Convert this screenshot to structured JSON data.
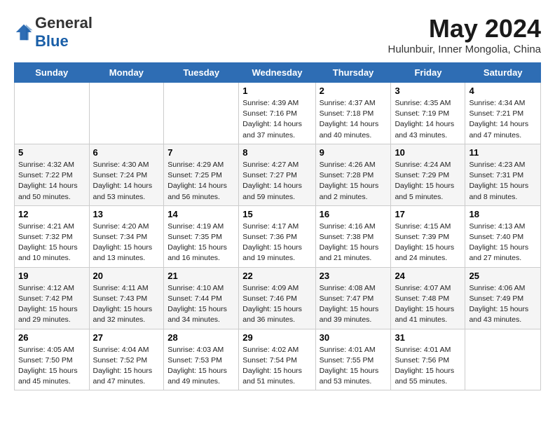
{
  "logo": {
    "general": "General",
    "blue": "Blue"
  },
  "title": "May 2024",
  "subtitle": "Hulunbuir, Inner Mongolia, China",
  "days_of_week": [
    "Sunday",
    "Monday",
    "Tuesday",
    "Wednesday",
    "Thursday",
    "Friday",
    "Saturday"
  ],
  "weeks": [
    [
      {
        "day": "",
        "info": ""
      },
      {
        "day": "",
        "info": ""
      },
      {
        "day": "",
        "info": ""
      },
      {
        "day": "1",
        "info": "Sunrise: 4:39 AM\nSunset: 7:16 PM\nDaylight: 14 hours and 37 minutes."
      },
      {
        "day": "2",
        "info": "Sunrise: 4:37 AM\nSunset: 7:18 PM\nDaylight: 14 hours and 40 minutes."
      },
      {
        "day": "3",
        "info": "Sunrise: 4:35 AM\nSunset: 7:19 PM\nDaylight: 14 hours and 43 minutes."
      },
      {
        "day": "4",
        "info": "Sunrise: 4:34 AM\nSunset: 7:21 PM\nDaylight: 14 hours and 47 minutes."
      }
    ],
    [
      {
        "day": "5",
        "info": "Sunrise: 4:32 AM\nSunset: 7:22 PM\nDaylight: 14 hours and 50 minutes."
      },
      {
        "day": "6",
        "info": "Sunrise: 4:30 AM\nSunset: 7:24 PM\nDaylight: 14 hours and 53 minutes."
      },
      {
        "day": "7",
        "info": "Sunrise: 4:29 AM\nSunset: 7:25 PM\nDaylight: 14 hours and 56 minutes."
      },
      {
        "day": "8",
        "info": "Sunrise: 4:27 AM\nSunset: 7:27 PM\nDaylight: 14 hours and 59 minutes."
      },
      {
        "day": "9",
        "info": "Sunrise: 4:26 AM\nSunset: 7:28 PM\nDaylight: 15 hours and 2 minutes."
      },
      {
        "day": "10",
        "info": "Sunrise: 4:24 AM\nSunset: 7:29 PM\nDaylight: 15 hours and 5 minutes."
      },
      {
        "day": "11",
        "info": "Sunrise: 4:23 AM\nSunset: 7:31 PM\nDaylight: 15 hours and 8 minutes."
      }
    ],
    [
      {
        "day": "12",
        "info": "Sunrise: 4:21 AM\nSunset: 7:32 PM\nDaylight: 15 hours and 10 minutes."
      },
      {
        "day": "13",
        "info": "Sunrise: 4:20 AM\nSunset: 7:34 PM\nDaylight: 15 hours and 13 minutes."
      },
      {
        "day": "14",
        "info": "Sunrise: 4:19 AM\nSunset: 7:35 PM\nDaylight: 15 hours and 16 minutes."
      },
      {
        "day": "15",
        "info": "Sunrise: 4:17 AM\nSunset: 7:36 PM\nDaylight: 15 hours and 19 minutes."
      },
      {
        "day": "16",
        "info": "Sunrise: 4:16 AM\nSunset: 7:38 PM\nDaylight: 15 hours and 21 minutes."
      },
      {
        "day": "17",
        "info": "Sunrise: 4:15 AM\nSunset: 7:39 PM\nDaylight: 15 hours and 24 minutes."
      },
      {
        "day": "18",
        "info": "Sunrise: 4:13 AM\nSunset: 7:40 PM\nDaylight: 15 hours and 27 minutes."
      }
    ],
    [
      {
        "day": "19",
        "info": "Sunrise: 4:12 AM\nSunset: 7:42 PM\nDaylight: 15 hours and 29 minutes."
      },
      {
        "day": "20",
        "info": "Sunrise: 4:11 AM\nSunset: 7:43 PM\nDaylight: 15 hours and 32 minutes."
      },
      {
        "day": "21",
        "info": "Sunrise: 4:10 AM\nSunset: 7:44 PM\nDaylight: 15 hours and 34 minutes."
      },
      {
        "day": "22",
        "info": "Sunrise: 4:09 AM\nSunset: 7:46 PM\nDaylight: 15 hours and 36 minutes."
      },
      {
        "day": "23",
        "info": "Sunrise: 4:08 AM\nSunset: 7:47 PM\nDaylight: 15 hours and 39 minutes."
      },
      {
        "day": "24",
        "info": "Sunrise: 4:07 AM\nSunset: 7:48 PM\nDaylight: 15 hours and 41 minutes."
      },
      {
        "day": "25",
        "info": "Sunrise: 4:06 AM\nSunset: 7:49 PM\nDaylight: 15 hours and 43 minutes."
      }
    ],
    [
      {
        "day": "26",
        "info": "Sunrise: 4:05 AM\nSunset: 7:50 PM\nDaylight: 15 hours and 45 minutes."
      },
      {
        "day": "27",
        "info": "Sunrise: 4:04 AM\nSunset: 7:52 PM\nDaylight: 15 hours and 47 minutes."
      },
      {
        "day": "28",
        "info": "Sunrise: 4:03 AM\nSunset: 7:53 PM\nDaylight: 15 hours and 49 minutes."
      },
      {
        "day": "29",
        "info": "Sunrise: 4:02 AM\nSunset: 7:54 PM\nDaylight: 15 hours and 51 minutes."
      },
      {
        "day": "30",
        "info": "Sunrise: 4:01 AM\nSunset: 7:55 PM\nDaylight: 15 hours and 53 minutes."
      },
      {
        "day": "31",
        "info": "Sunrise: 4:01 AM\nSunset: 7:56 PM\nDaylight: 15 hours and 55 minutes."
      },
      {
        "day": "",
        "info": ""
      }
    ]
  ]
}
